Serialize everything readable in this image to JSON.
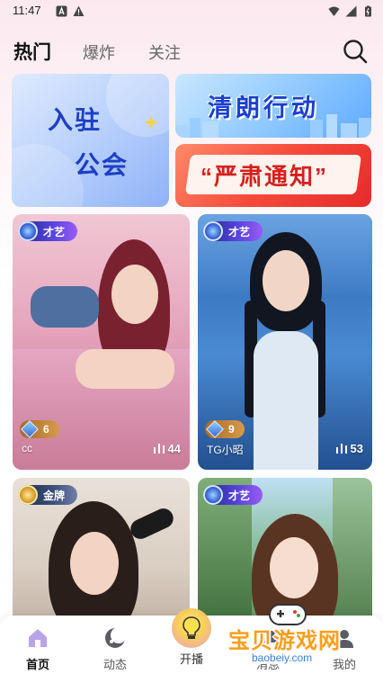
{
  "status_bar": {
    "time": "11:47"
  },
  "top_nav": {
    "tabs": [
      {
        "label": "热门",
        "active": true
      },
      {
        "label": "爆炸",
        "active": false
      },
      {
        "label": "关注",
        "active": false
      }
    ]
  },
  "banners": {
    "guild": {
      "line1": "入驻",
      "line2": "公会"
    },
    "clear": {
      "text": "清朗行动"
    },
    "notice": {
      "text": "“严肃通知”"
    }
  },
  "cards": [
    {
      "badge": "才艺",
      "rank": "6",
      "name": "cc",
      "views": "44"
    },
    {
      "badge": "才艺",
      "rank": "9",
      "name": "TG小昭",
      "views": "53"
    },
    {
      "badge": "金牌"
    },
    {
      "badge": "才艺"
    }
  ],
  "bottom_nav": {
    "items": [
      {
        "label": "首页",
        "active": true
      },
      {
        "label": "动态",
        "active": false
      },
      {
        "label": "开播",
        "active": false
      },
      {
        "label": "消息",
        "active": false
      },
      {
        "label": "我的",
        "active": false
      }
    ]
  },
  "watermark": {
    "text": "宝贝游戏网",
    "url": "baobeiy.com"
  },
  "colors": {
    "accent_blue": "#1d3fc6",
    "notice_red": "#e52b2b",
    "watermark_orange": "#ff9d1c"
  }
}
